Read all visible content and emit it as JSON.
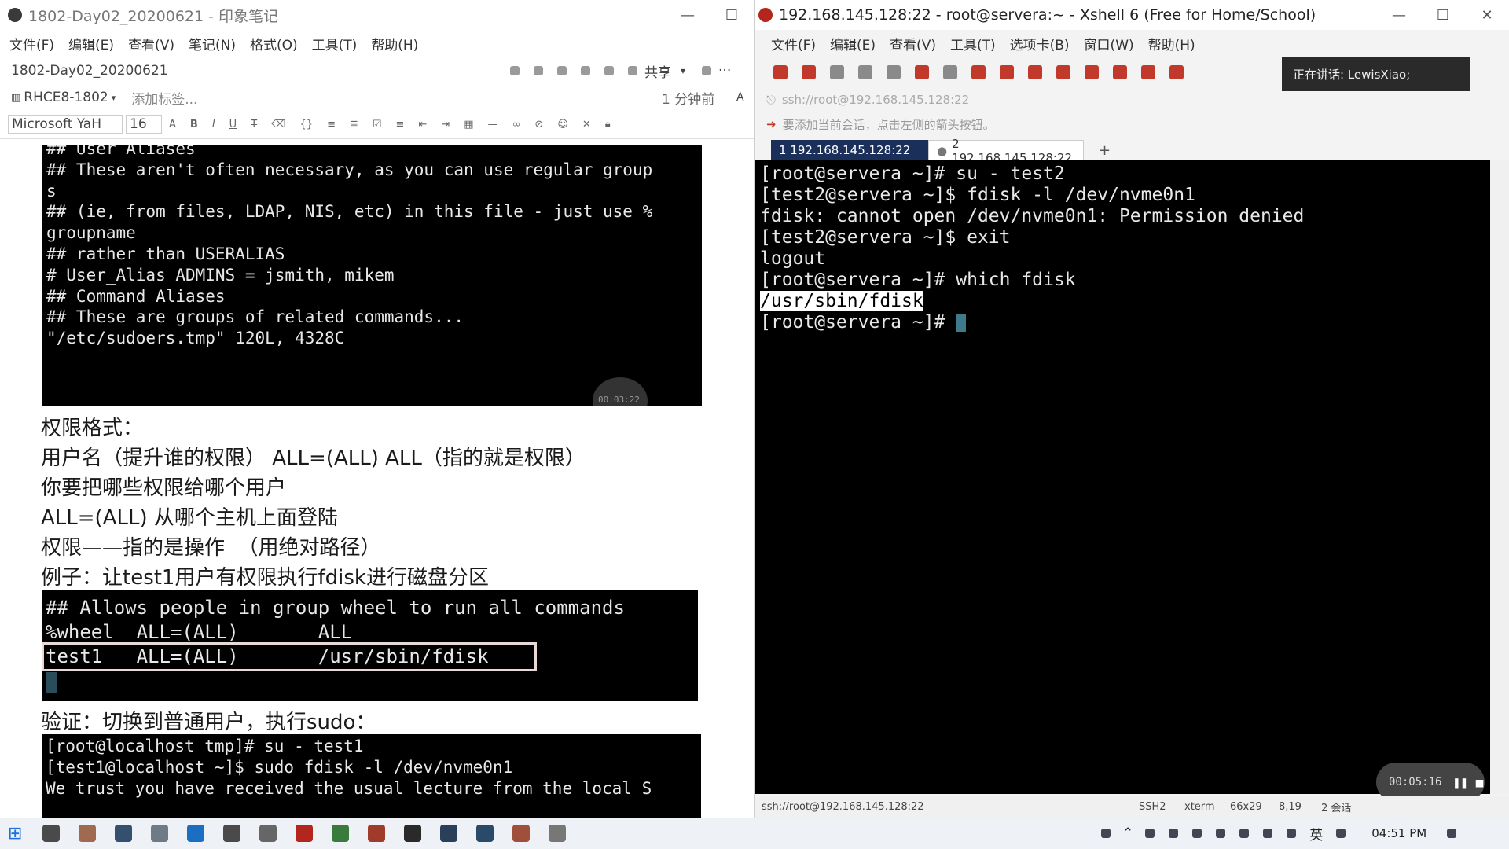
{
  "left": {
    "title": "1802-Day02_20200621 - 印象笔记",
    "menu": [
      "文件(F)",
      "编辑(E)",
      "查看(V)",
      "笔记(N)",
      "格式(O)",
      "工具(T)",
      "帮助(H)"
    ],
    "note_title": "1802-Day02_20200621",
    "share_label": "共享",
    "notebook": "RHCE8-1802",
    "add_tag": "添加标签...",
    "time_ago": "1 分钟前",
    "font_name": "Microsoft YaH",
    "font_size": "16",
    "term1_lines": [
      "## User Aliases",
      "## These aren't often necessary, as you can use regular group",
      "s",
      "## (ie, from files, LDAP, NIS, etc) in this file - just use %",
      "groupname",
      "## rather than USERALIAS",
      "# User_Alias ADMINS = jsmith, mikem",
      "",
      "",
      "## Command Aliases",
      "## These are groups of related commands...",
      "\"/etc/sudoers.tmp\" 120L, 4328C"
    ],
    "notes": [
      "权限格式：",
      "用户名（提升谁的权限） ALL=(ALL) ALL（指的就是权限）",
      "你要把哪些权限给哪个用户",
      "ALL=(ALL) 从哪个主机上面登陆",
      "权限——指的是操作  （用绝对路径）",
      "例子：让test1用户有权限执行fdisk进行磁盘分区"
    ],
    "term2_lines": [
      "## Allows people in group wheel to run all commands",
      "%wheel  ALL=(ALL)       ALL",
      "test1   ALL=(ALL)       /usr/sbin/fdisk"
    ],
    "verify_label": "验证：切换到普通用户，执行sudo：",
    "term3_lines": [
      "[root@localhost tmp]# su - test1",
      "[test1@localhost ~]$ sudo fdisk -l /dev/nvme0n1",
      "",
      "We trust you have received the usual lecture from the local S"
    ],
    "rec_time_small": "00:03:22"
  },
  "right": {
    "title": "192.168.145.128:22 - root@servera:~ - Xshell 6 (Free for Home/School)",
    "menu": [
      "文件(F)",
      "编辑(E)",
      "查看(V)",
      "工具(T)",
      "选项卡(B)",
      "窗口(W)",
      "帮助(H)"
    ],
    "speaking": "正在讲话: LewisXiao;",
    "address": "ssh://root@192.168.145.128:22",
    "session_hint": "要添加当前会话，点击左侧的箭头按钮。",
    "tabs": [
      "1 192.168.145.128:22",
      "2 192.168.145.128:22"
    ],
    "terminal_lines": [
      "[root@servera ~]# su - test2",
      "[test2@servera ~]$ fdisk -l /dev/nvme0n1",
      "fdisk: cannot open /dev/nvme0n1: Permission denied",
      "[test2@servera ~]$ exit",
      "logout",
      "[root@servera ~]# which fdisk",
      "/usr/sbin/fdisk",
      "[root@servera ~]# "
    ],
    "status": {
      "address": "ssh://root@192.168.145.128:22",
      "proto": "SSH2",
      "term": "xterm",
      "size": "66x29",
      "pos": "8,19",
      "sessions": "2 会话"
    },
    "rec_time": "00:05:16"
  },
  "taskbar": {
    "lang": "英",
    "clock": "04:51 PM"
  }
}
